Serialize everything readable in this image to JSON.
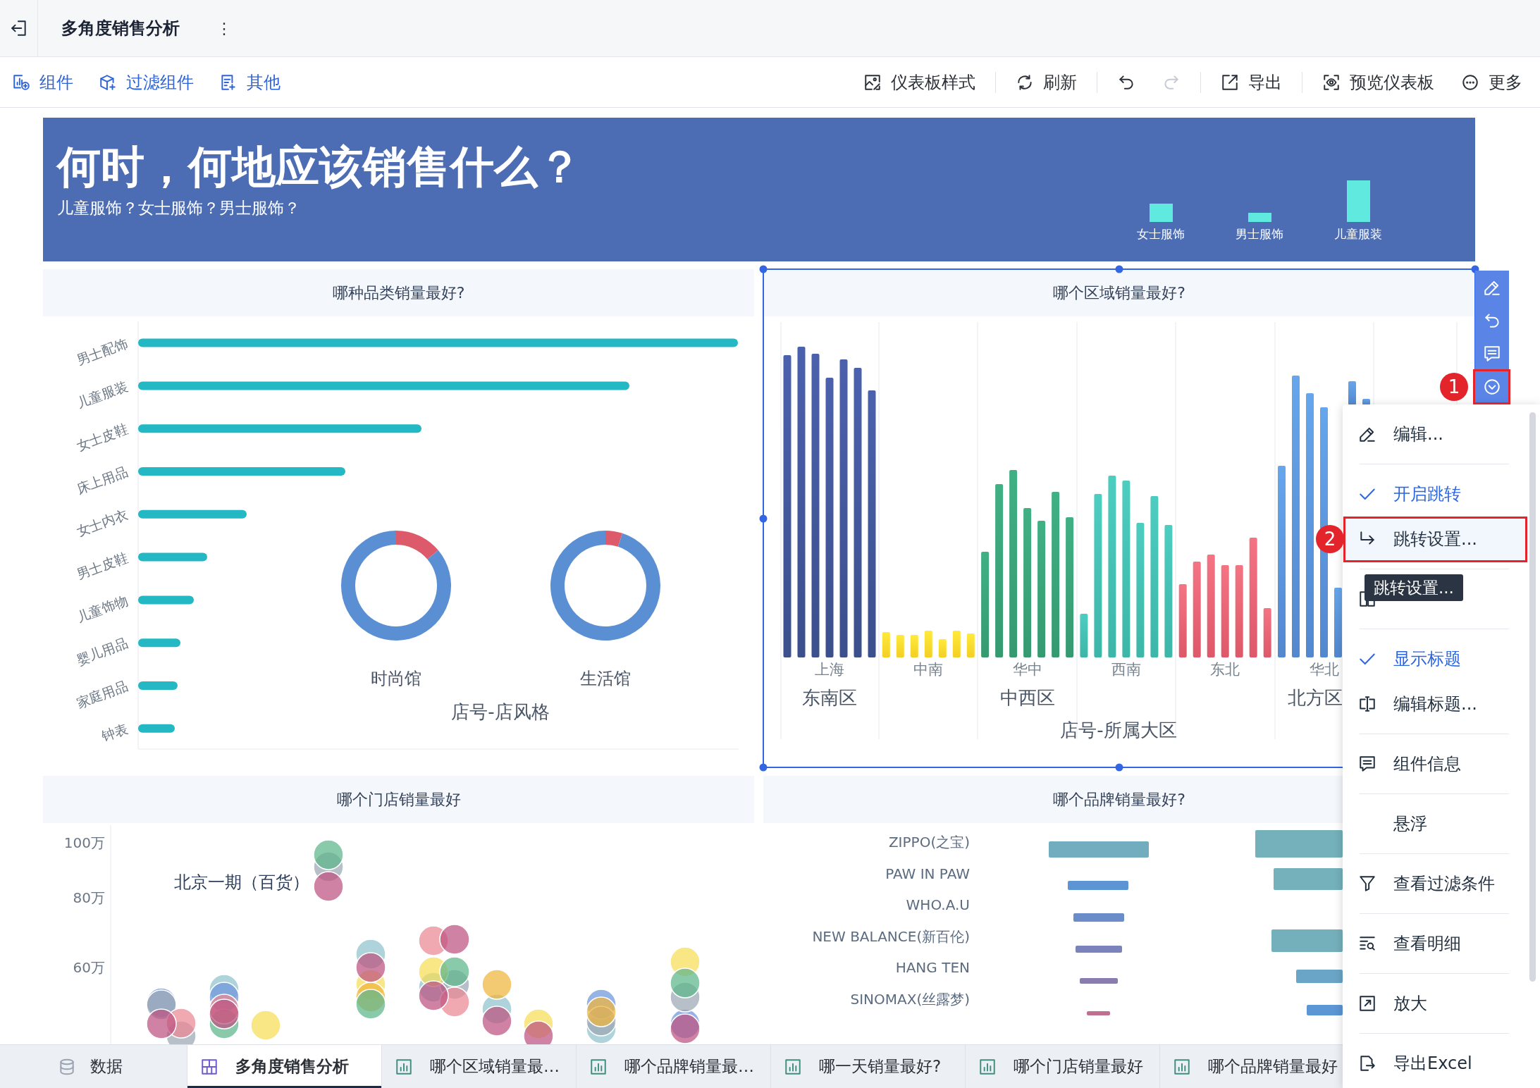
{
  "header": {
    "title": "多角度销售分析",
    "menu_glyph": "⋮"
  },
  "toolbar": {
    "left": [
      {
        "label": "组件"
      },
      {
        "label": "过滤组件"
      },
      {
        "label": "其他"
      }
    ],
    "right_groups": [
      [
        {
          "label": "仪表板样式",
          "disabled": false
        }
      ],
      [
        {
          "label": "刷新",
          "disabled": false
        }
      ],
      [
        {
          "disabled": false
        },
        {
          "disabled": true
        }
      ],
      [
        {
          "label": "导出",
          "disabled": false
        }
      ],
      [
        {
          "label": "预览仪表板",
          "disabled": false
        },
        {
          "label": "更多",
          "disabled": false
        }
      ]
    ]
  },
  "banner": {
    "title": "何时，何地应该销售什么？",
    "subtitle": "儿童服饰？女士服饰？男士服饰？",
    "mini_chart_labels": [
      "女士服饰",
      "男士服饰",
      "儿童服装"
    ]
  },
  "panels": [
    {
      "kind": "category_bars",
      "title": "哪种品类销量最好?",
      "selected": false,
      "categories": [
        "男士配饰",
        "儿童服装",
        "女士皮鞋",
        "床上用品",
        "女士内衣",
        "男士皮鞋",
        "儿童饰物",
        "婴儿用品",
        "家庭用品",
        "钟表"
      ],
      "donut_labels": [
        "时尚馆",
        "生活馆"
      ],
      "axis_title": "店号-店风格"
    },
    {
      "kind": "region_bars",
      "title": "哪个区域销量最好?",
      "selected": true,
      "regions": [
        "上海",
        "中南",
        "华中",
        "西南",
        "东北",
        "华北"
      ],
      "groups": [
        "东南区",
        "中西区",
        "北方区"
      ],
      "axis_title": "店号-所属大区"
    },
    {
      "kind": "bubbles",
      "title": "哪个门店销量最好",
      "selected": false,
      "y_axis_labels": [
        "100万",
        "80万",
        "60万"
      ],
      "point_label": "北京一期（百货）"
    },
    {
      "kind": "brand_bars",
      "title": "哪个品牌销量最好?",
      "selected": false,
      "brands": [
        "ZIPPO(之宝)",
        "PAW IN PAW",
        "WHO.A.U",
        "NEW BALANCE(新百伦)",
        "HANG TEN",
        "SINOMAX(丝露梦)"
      ]
    }
  ],
  "context_menu": {
    "groups": [
      [
        {
          "label": "编辑...",
          "checked": false,
          "selected": false
        }
      ],
      [
        {
          "label": "开启跳转",
          "checked": true,
          "selected": false
        },
        {
          "label": "跳转设置...",
          "checked": false,
          "selected": true
        }
      ],
      [
        {
          "checked": false,
          "selected": false
        }
      ],
      [
        {
          "label": "显示标题",
          "checked": true,
          "selected": false
        },
        {
          "label": "编辑标题...",
          "checked": false,
          "selected": false
        }
      ],
      [
        {
          "label": "组件信息",
          "checked": false,
          "selected": false
        }
      ],
      [
        {
          "label": "悬浮",
          "checked": false,
          "selected": false
        }
      ],
      [
        {
          "label": "查看过滤条件",
          "checked": false,
          "selected": false
        }
      ],
      [
        {
          "label": "查看明细",
          "checked": false,
          "selected": false
        }
      ],
      [
        {
          "label": "放大",
          "checked": false,
          "selected": false
        }
      ],
      [
        {
          "label": "导出Excel",
          "checked": false,
          "selected": false
        }
      ]
    ],
    "tooltip": "跳转设置..."
  },
  "callouts": [
    {
      "number": "1"
    },
    {
      "number": "2"
    }
  ],
  "tabs": [
    {
      "kind": "data",
      "label": "数据",
      "selected": false
    },
    {
      "kind": "dashboard",
      "label": "多角度销售分析",
      "selected": true
    },
    {
      "kind": "chart",
      "label": "哪个区域销量最…",
      "selected": false
    },
    {
      "kind": "chart",
      "label": "哪个品牌销量最…",
      "selected": false
    },
    {
      "kind": "chart",
      "label": "哪一天销量最好?",
      "selected": false
    },
    {
      "kind": "chart",
      "label": "哪个门店销量最好",
      "selected": false
    },
    {
      "kind": "chart",
      "label": "哪个品牌销量最好",
      "selected": false
    }
  ]
}
